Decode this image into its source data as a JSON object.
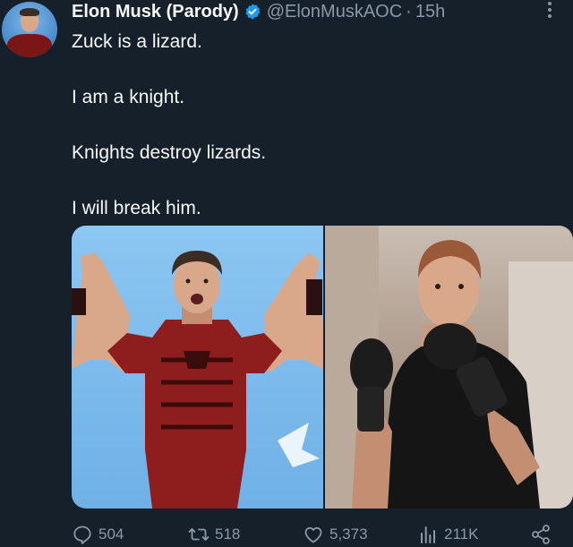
{
  "tweet": {
    "display_name": "Elon Musk (Parody)",
    "handle": "@ElonMuskAOC",
    "separator": "·",
    "time": "15h",
    "lines": [
      "Zuck is a lizard.",
      "I am a knight.",
      "Knights destroy lizards.",
      "I will break him."
    ]
  },
  "actions": {
    "replies": "504",
    "retweets": "518",
    "likes": "5,373",
    "views": "211K"
  },
  "colors": {
    "background": "#15202b",
    "text": "#f7f9f9",
    "muted": "#8b98a5",
    "verified": "#1d9bf0"
  },
  "icons": [
    "more-icon",
    "verified-badge-icon",
    "reply-icon",
    "retweet-icon",
    "like-icon",
    "views-icon",
    "share-icon"
  ]
}
